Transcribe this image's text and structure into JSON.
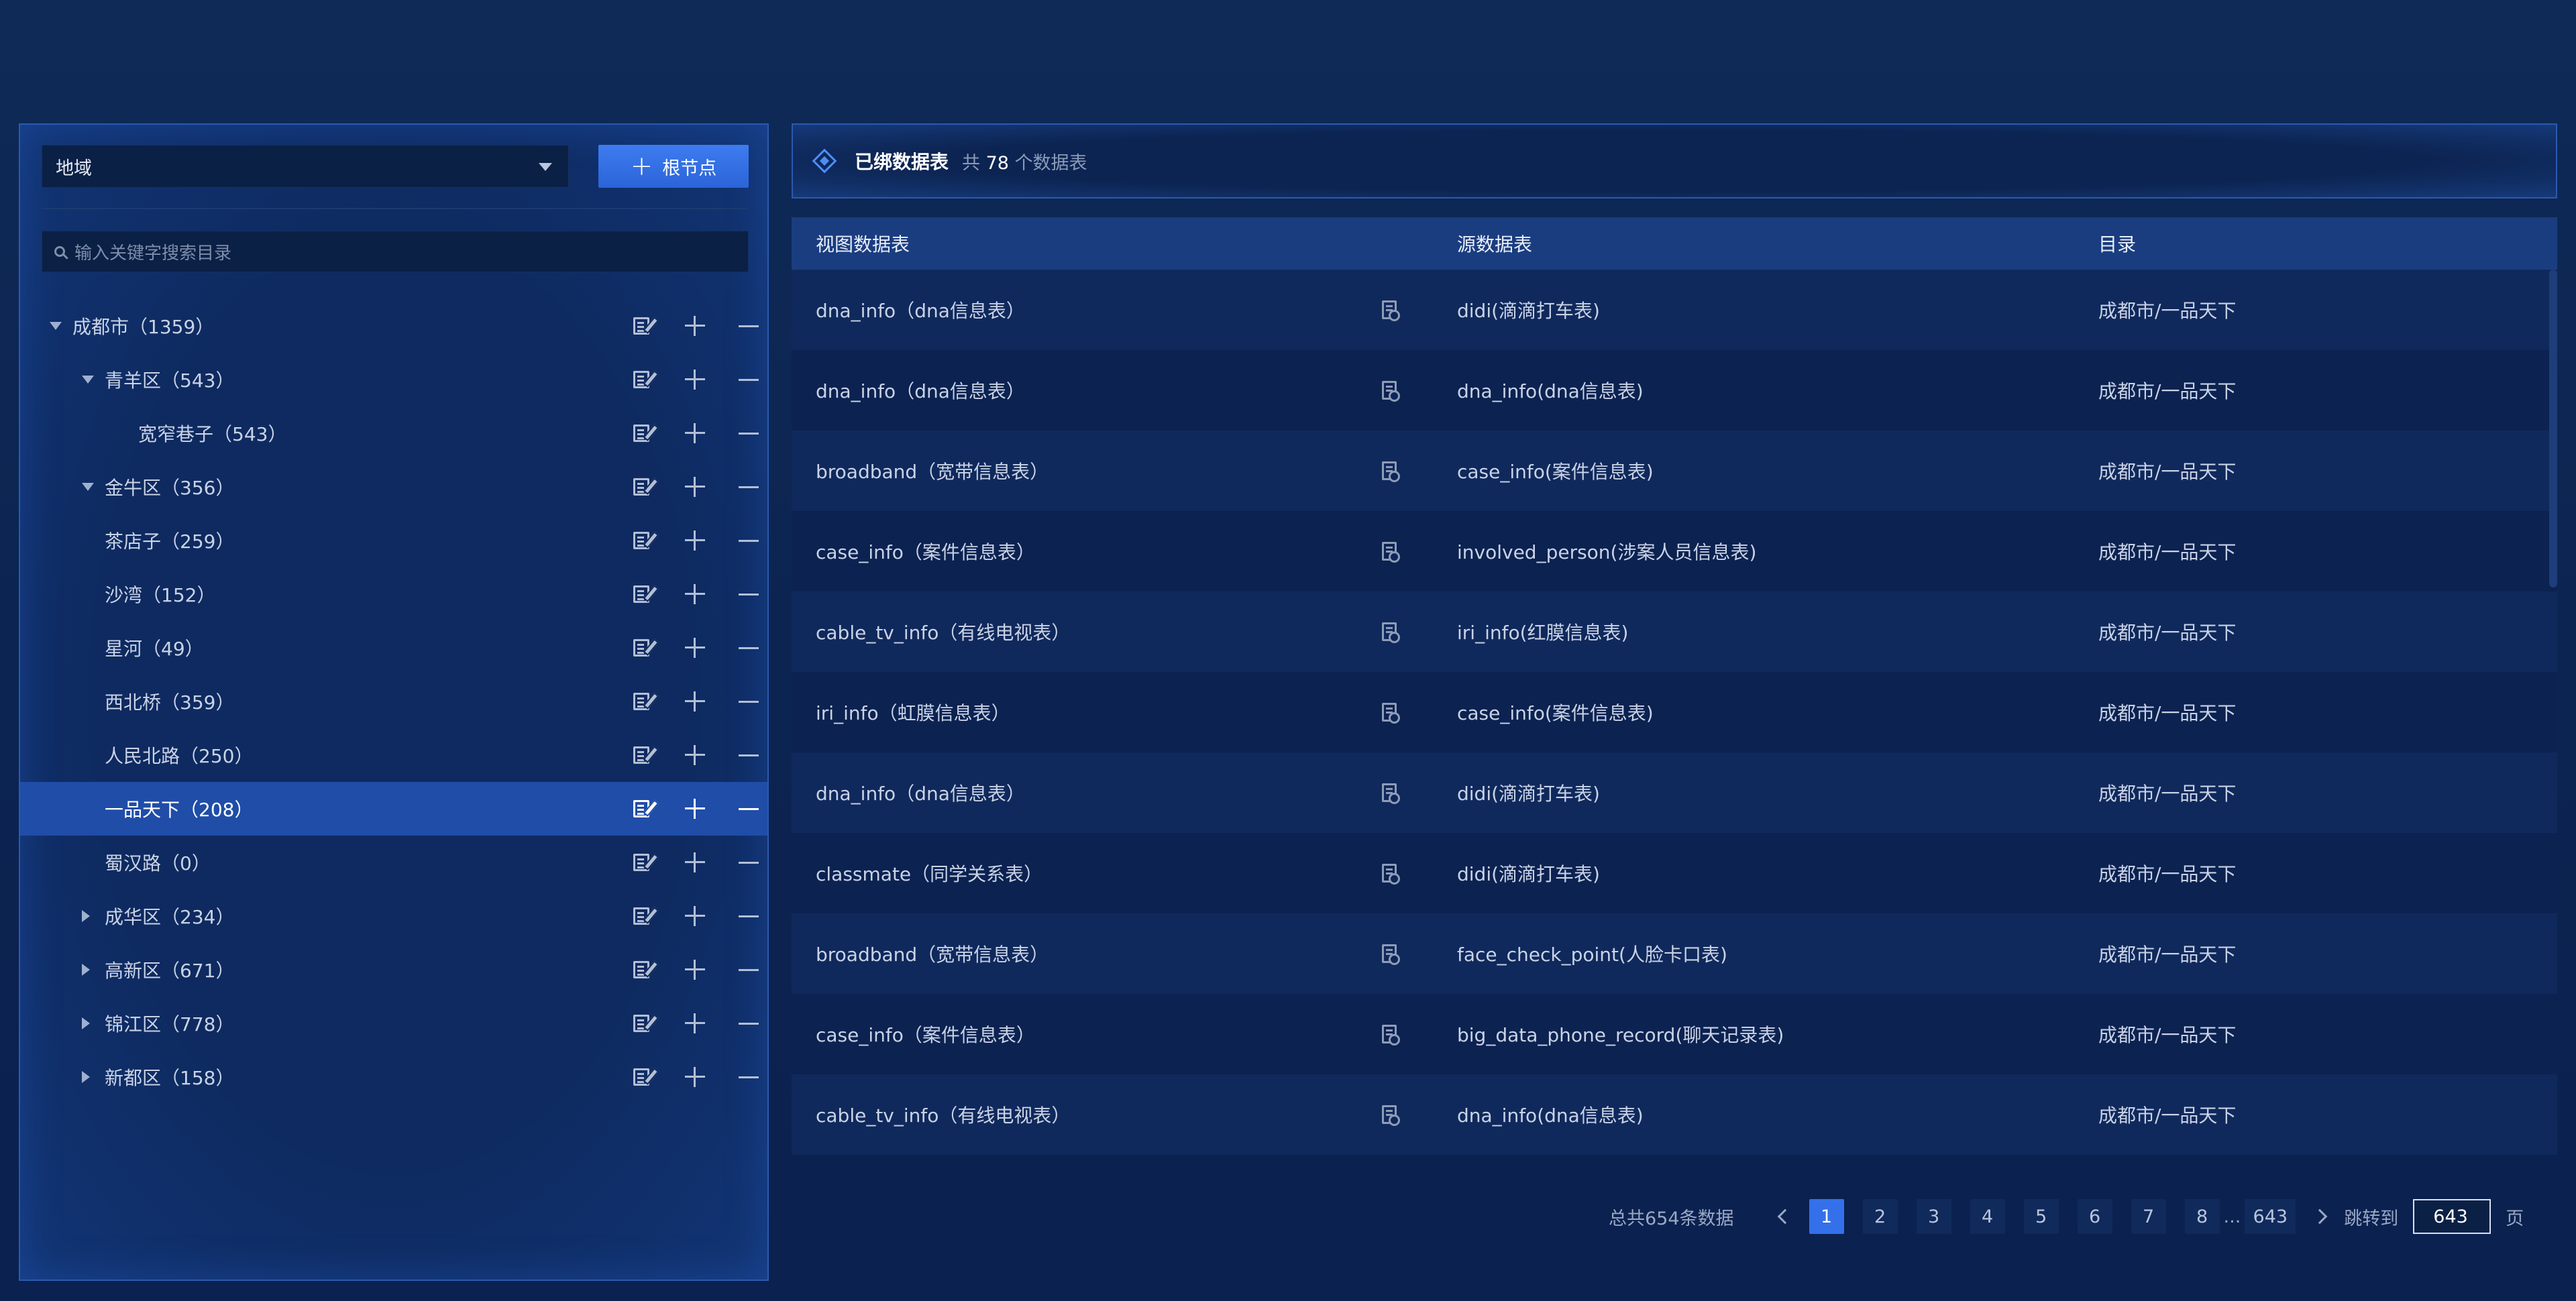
{
  "left": {
    "region_select": {
      "value": "地域"
    },
    "root_button": {
      "plus": "+",
      "label": "根节点"
    },
    "search": {
      "placeholder": "输入关键字搜索目录"
    },
    "tree": [
      {
        "label": "成都市（1359）",
        "indent": 0,
        "arrow": "down",
        "selected": false
      },
      {
        "label": "青羊区（543）",
        "indent": 1,
        "arrow": "down",
        "selected": false
      },
      {
        "label": "宽窄巷子（543）",
        "indent": 2,
        "arrow": "",
        "selected": false
      },
      {
        "label": "金牛区（356）",
        "indent": 1,
        "arrow": "down",
        "selected": false
      },
      {
        "label": "茶店子（259）",
        "indent": 1,
        "arrow": "",
        "selected": false
      },
      {
        "label": "沙湾（152）",
        "indent": 1,
        "arrow": "",
        "selected": false
      },
      {
        "label": "星河（49）",
        "indent": 1,
        "arrow": "",
        "selected": false
      },
      {
        "label": "西北桥（359）",
        "indent": 1,
        "arrow": "",
        "selected": false
      },
      {
        "label": "人民北路（250）",
        "indent": 1,
        "arrow": "",
        "selected": false
      },
      {
        "label": "一品天下（208）",
        "indent": 1,
        "arrow": "",
        "selected": true
      },
      {
        "label": "蜀汉路（0）",
        "indent": 1,
        "arrow": "",
        "selected": false
      },
      {
        "label": "成华区（234）",
        "indent": 1,
        "arrow": "right",
        "selected": false
      },
      {
        "label": "高新区（671）",
        "indent": 1,
        "arrow": "right",
        "selected": false
      },
      {
        "label": "锦江区（778）",
        "indent": 1,
        "arrow": "right",
        "selected": false
      },
      {
        "label": "新都区（158）",
        "indent": 1,
        "arrow": "right",
        "selected": false
      }
    ]
  },
  "header": {
    "title": "已绑数据表",
    "count_prefix": "共",
    "count": "78",
    "count_suffix": "个数据表"
  },
  "table": {
    "columns": [
      "视图数据表",
      "源数据表",
      "目录"
    ],
    "rows": [
      [
        "dna_info（dna信息表）",
        "didi(滴滴打车表)",
        "成都市/一品天下"
      ],
      [
        "dna_info（dna信息表）",
        "dna_info(dna信息表)",
        "成都市/一品天下"
      ],
      [
        "broadband（宽带信息表）",
        "case_info(案件信息表)",
        "成都市/一品天下"
      ],
      [
        "case_info（案件信息表）",
        "involved_person(涉案人员信息表)",
        "成都市/一品天下"
      ],
      [
        "cable_tv_info（有线电视表）",
        "iri_info(红膜信息表)",
        "成都市/一品天下"
      ],
      [
        "iri_info（虹膜信息表）",
        "case_info(案件信息表)",
        "成都市/一品天下"
      ],
      [
        "dna_info（dna信息表）",
        "didi(滴滴打车表)",
        "成都市/一品天下"
      ],
      [
        "classmate（同学关系表）",
        "didi(滴滴打车表)",
        "成都市/一品天下"
      ],
      [
        "broadband（宽带信息表）",
        "face_check_point(人脸卡口表)",
        "成都市/一品天下"
      ],
      [
        "case_info（案件信息表）",
        "big_data_phone_record(聊天记录表)",
        "成都市/一品天下"
      ],
      [
        "cable_tv_info（有线电视表）",
        "dna_info(dna信息表)",
        "成都市/一品天下"
      ]
    ]
  },
  "pagination": {
    "total": "总共654条数据",
    "pages": [
      "1",
      "2",
      "3",
      "4",
      "5",
      "6",
      "7",
      "8"
    ],
    "ellipsis": "...",
    "last_page": "643",
    "current": "1",
    "jump_label": "跳转到",
    "jump_value": "643",
    "page_suffix": "页"
  },
  "icons": {
    "edit": "edit-icon",
    "add": "plus-icon",
    "remove": "minus-icon",
    "view": "view-doc-icon",
    "search": "search-icon",
    "header": "diamond-icon"
  },
  "colors": {
    "accent": "#3470ea",
    "selected_row": "#1f4da8",
    "background": "#0c2451"
  }
}
